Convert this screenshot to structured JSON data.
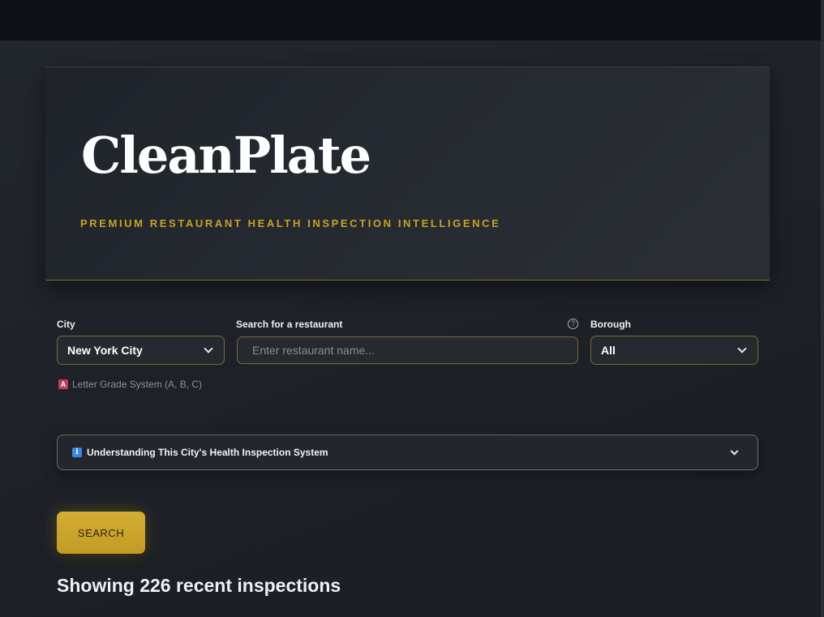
{
  "hero": {
    "title": "CleanPlate",
    "subtitle": "PREMIUM RESTAURANT HEALTH INSPECTION INTELLIGENCE"
  },
  "filters": {
    "city": {
      "label": "City",
      "value": "New York City"
    },
    "search": {
      "label": "Search for a restaurant",
      "placeholder": "Enter restaurant name...",
      "value": "",
      "help_icon": "question-circle-icon"
    },
    "borough": {
      "label": "Borough",
      "value": "All"
    }
  },
  "grade_note": {
    "badge": "A",
    "text": "Letter Grade System (A, B, C)"
  },
  "expander": {
    "icon": "info-icon",
    "icon_glyph": "i",
    "label": "Understanding This City's Health Inspection System"
  },
  "search_button": {
    "label": "SEARCH"
  },
  "results": {
    "heading": "Showing 226 recent inspections"
  },
  "colors": {
    "accent_gold": "#c9a227",
    "background": "#1d2026",
    "topbar": "#0e1117",
    "grade_badge": "#c03c5a",
    "info_badge": "#3d86e0"
  }
}
